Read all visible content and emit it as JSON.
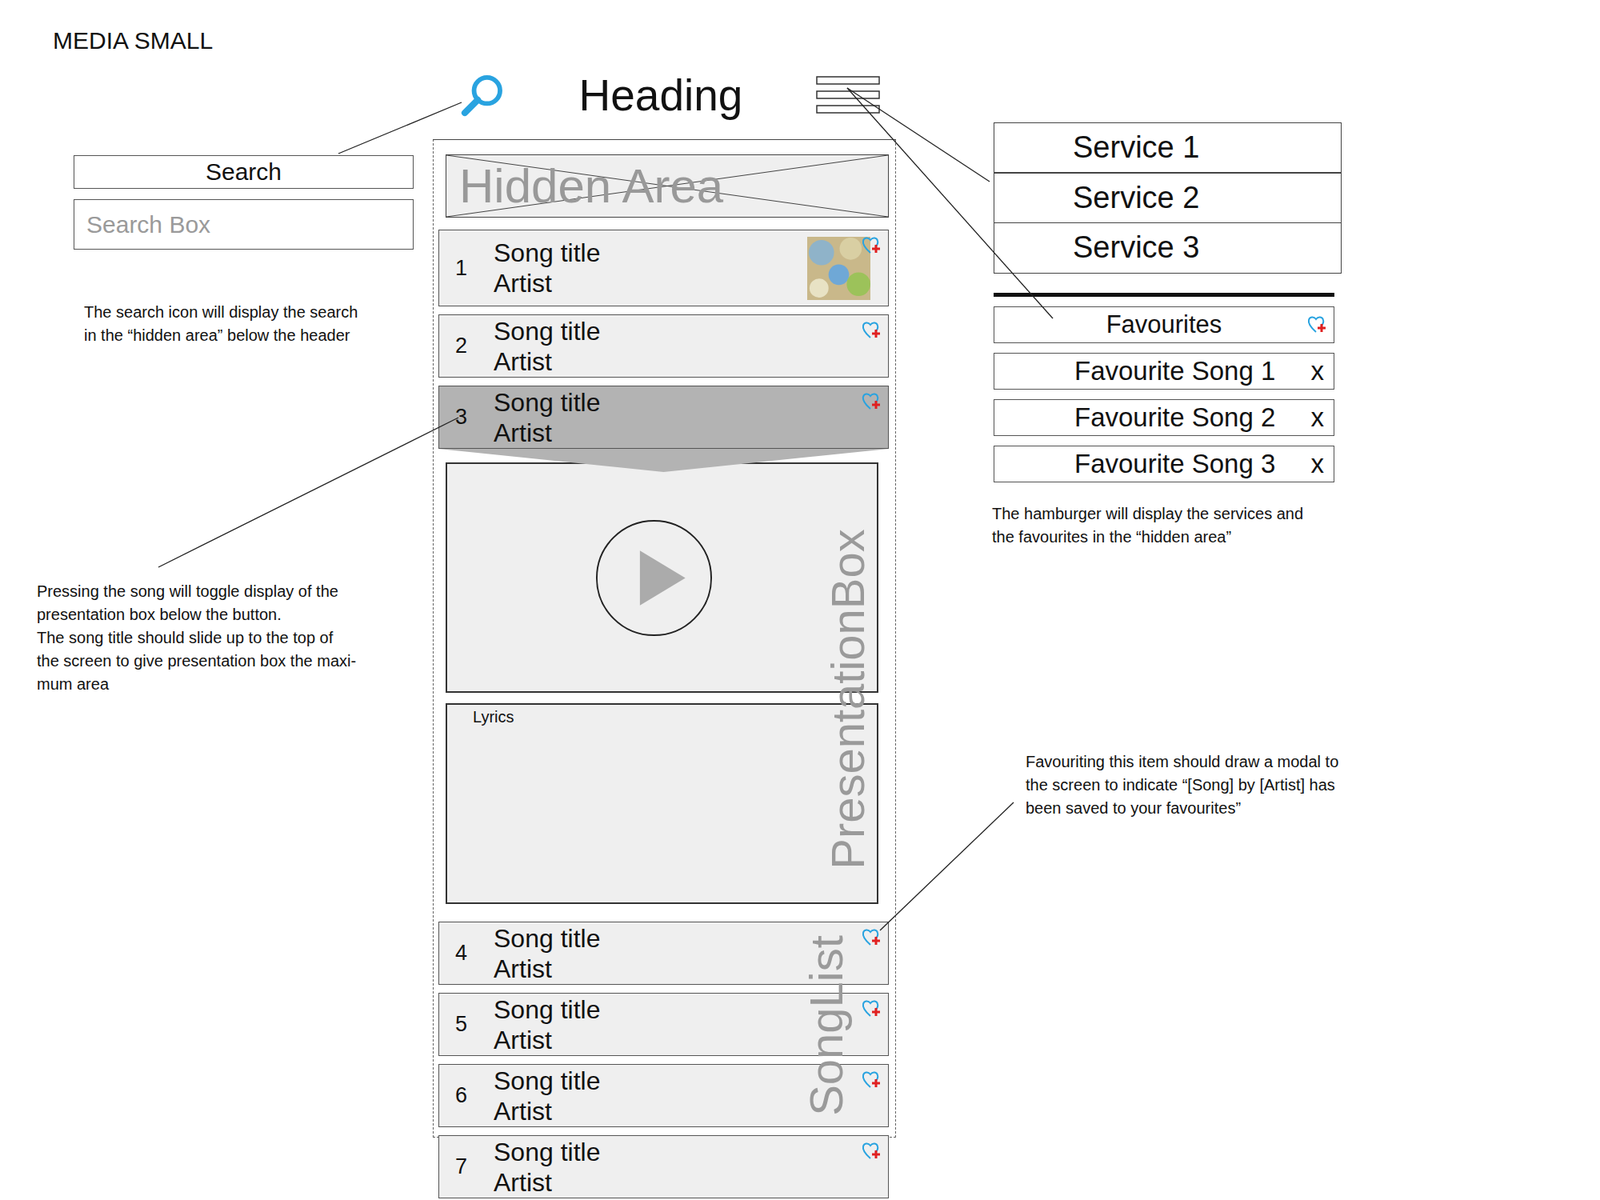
{
  "page_title": "MEDIA SMALL",
  "header": {
    "title": "Heading"
  },
  "hidden_area": {
    "label": "Hidden Area"
  },
  "search": {
    "label": "Search",
    "placeholder": "Search Box"
  },
  "notes": {
    "search": [
      "The search icon will display the search",
      "in the “hidden area” below the header"
    ],
    "song": [
      "Pressing the song will toggle display of the",
      "presentation box below the button.",
      "The song title should slide up to the top of",
      "the screen to give presentation box the maxi-",
      "mum area"
    ],
    "hamburger": [
      "The hamburger will display the services and",
      "the favourites in the “hidden area”"
    ],
    "favourite": [
      "Favouriting this item should draw a modal to",
      "the screen to indicate “[Song] by [Artist] has",
      "been saved to your favourites”"
    ]
  },
  "services": [
    "Service 1",
    "Service 2",
    "Service 3"
  ],
  "favourites": {
    "title": "Favourites",
    "items": [
      {
        "title": "Favourite Song 1",
        "remove": "x"
      },
      {
        "title": "Favourite Song 2",
        "remove": "x"
      },
      {
        "title": "Favourite Song 3",
        "remove": "x"
      }
    ]
  },
  "songs": [
    {
      "number": "1",
      "title": "Song title",
      "artist": "Artist",
      "selected": false,
      "has_thumbnail": true
    },
    {
      "number": "2",
      "title": "Song title",
      "artist": "Artist",
      "selected": false,
      "has_thumbnail": false
    },
    {
      "number": "3",
      "title": "Song title",
      "artist": "Artist",
      "selected": true,
      "has_thumbnail": false
    },
    {
      "number": "4",
      "title": "Song title",
      "artist": "Artist",
      "selected": false,
      "has_thumbnail": false
    },
    {
      "number": "5",
      "title": "Song title",
      "artist": "Artist",
      "selected": false,
      "has_thumbnail": false
    },
    {
      "number": "6",
      "title": "Song title",
      "artist": "Artist",
      "selected": false,
      "has_thumbnail": false
    },
    {
      "number": "7",
      "title": "Song title",
      "artist": "Artist",
      "selected": false,
      "has_thumbnail": false
    }
  ],
  "presentation": {
    "label": "PresentationBox",
    "lyrics_label": "Lyrics"
  },
  "song_list_label": "SongList"
}
